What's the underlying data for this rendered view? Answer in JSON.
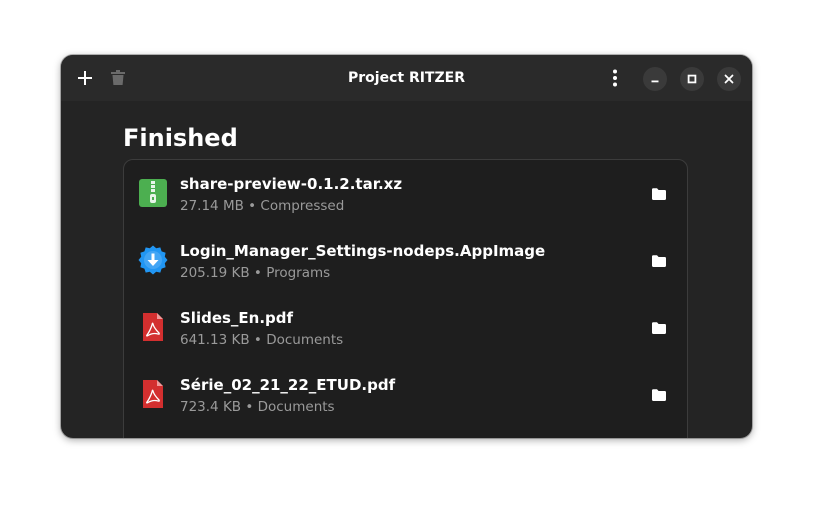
{
  "window": {
    "title": "Project RITZER"
  },
  "header": {
    "add_icon": "plus-icon",
    "delete_icon": "trash-icon",
    "menu_icon": "kebab-menu-icon",
    "minimize_icon": "minimize-icon",
    "maximize_icon": "maximize-icon",
    "close_icon": "close-icon"
  },
  "section": {
    "heading": "Finished"
  },
  "downloads": [
    {
      "name": "share-preview-0.1.2.tar.xz",
      "size": "27.14 MB",
      "category": "Compressed",
      "subtitle": "27.14 MB • Compressed",
      "icon": "archive-icon"
    },
    {
      "name": "Login_Manager_Settings-nodeps.AppImage",
      "size": "205.19 KB",
      "category": "Programs",
      "subtitle": "205.19 KB • Programs",
      "icon": "installer-icon"
    },
    {
      "name": "Slides_En.pdf",
      "size": "641.13 KB",
      "category": "Documents",
      "subtitle": "641.13 KB • Documents",
      "icon": "pdf-icon"
    },
    {
      "name": "Série_02_21_22_ETUD.pdf",
      "size": "723.4 KB",
      "category": "Documents",
      "subtitle": "723.4 KB • Documents",
      "icon": "pdf-icon"
    }
  ],
  "colors": {
    "window_bg": "#242424",
    "headerbar_bg": "#2a2a2a",
    "card_bg": "#1e1e1e",
    "archive_green": "#4caf50",
    "installer_blue": "#2196f3",
    "pdf_red": "#d32f2f"
  }
}
